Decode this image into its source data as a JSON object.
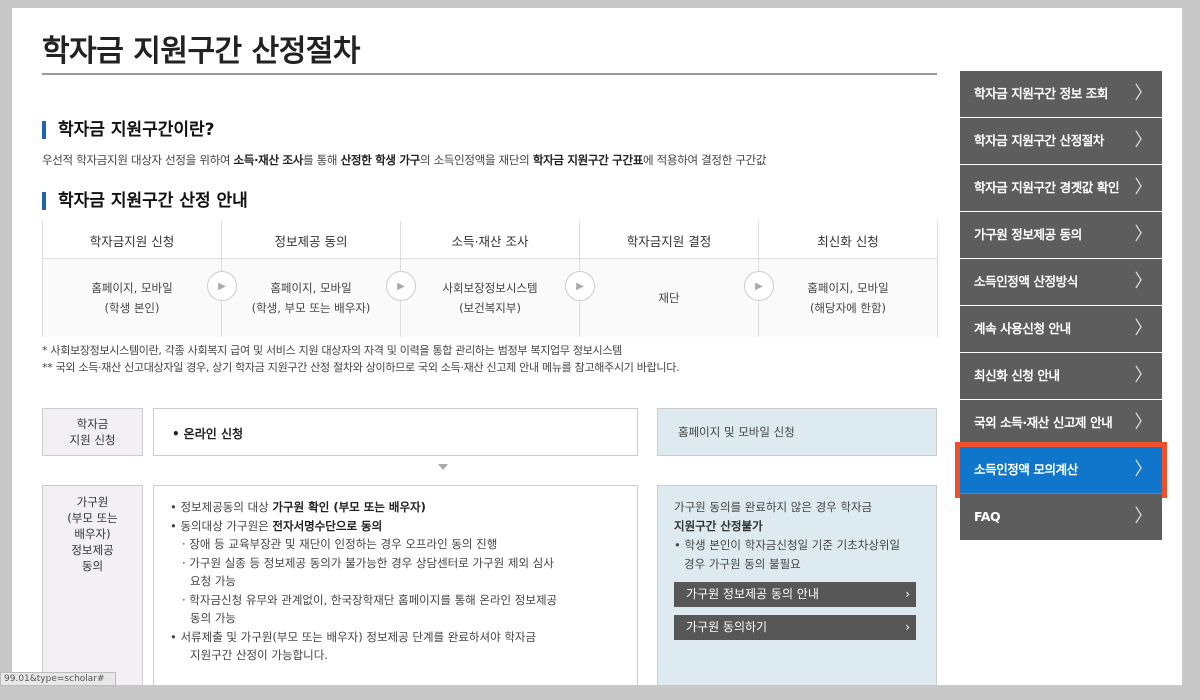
{
  "page_title": "학자금 지원구간 산정절차",
  "section1": {
    "heading": "학자금 지원구간이란?",
    "desc_pre": "우선적 학자금지원 대상자 선정을 위하여 ",
    "desc_b1": "소득·재산 조사",
    "desc_mid1": "를 통해 ",
    "desc_b2": "산정한 학생 가구",
    "desc_mid2": "의 소득인정액을 재단의 ",
    "desc_b3": "학자금 지원구간 구간표",
    "desc_post": "에 적용하여 결정한 구간값"
  },
  "section2": {
    "heading": "학자금 지원구간 산정 안내",
    "steps": [
      {
        "head": "학자금지원 신청",
        "line1": "홈페이지, 모바일",
        "line2": "(학생 본인)"
      },
      {
        "head": "정보제공 동의",
        "line1": "홈페이지, 모바일",
        "line2": "(학생, 부모 또는 배우자)"
      },
      {
        "head": "소득·재산 조사",
        "line1": "사회보장정보시스템",
        "line2": "(보건복지부)"
      },
      {
        "head": "학자금지원 결정",
        "line1": "재단",
        "line2": ""
      },
      {
        "head": "최신화 신청",
        "line1": "홈페이지, 모바일",
        "line2": "(해당자에 한함)"
      }
    ],
    "arrow_glyph": "▶",
    "note1": "* 사회보장정보시스템이란, 각종 사회복지 급여 및 서비스 지원 대상자의 자격 및 이력을 통합 관리하는 범정부 복지업무 정보시스템",
    "note2": "** 국외 소득·재산 신고대상자일 경우, 상기 학자금 지원구간 산정 절차와 상이하므로 국외 소득·재산 신고제 안내 메뉴를 참고해주시기 바랍니다."
  },
  "flow": {
    "row1": {
      "label_line1": "학자금",
      "label_line2": "지원 신청",
      "content": "온라인 신청",
      "side": "홈페이지 및 모바일 신청"
    },
    "row2": {
      "label_lines": [
        "가구원",
        "(부모 또는",
        "배우자)",
        "정보제공",
        "동의"
      ],
      "d1_pre": "정보제공동의 대상 ",
      "d1_b": "가구원 확인 (부모 또는 배우자)",
      "d2_pre": "동의대상 가구원은 ",
      "d2_b": "전자서명수단으로 동의",
      "d3": "· 장애 등 교육부장관 및 재단이 인정하는 경우 오프라인 동의 진행",
      "d4a": "· 가구원 실종 등 정보제공 동의가 불가능한 경우 상담센터로 가구원 제외 심사",
      "d4b": "요청 가능",
      "d5a": "· 학자금신청 유무와 관계없이, 한국장학재단 홈페이지를 통해 온라인 정보제공",
      "d5b": "동의 가능",
      "d6a": "서류제출 및 가구원(부모 또는 배우자) 정보제공 단계를 완료하셔야 학자금",
      "d6b": "지원구간 산정이 가능합니다.",
      "info_line1": "가구원 동의를 완료하지 않은 경우 학자금",
      "info_line2": "지원구간 산정불가",
      "info_line3": "• 학생 본인이 학자금신청일 기준 기초차상위일",
      "info_line4": "경우 가구원 동의 불필요",
      "btn1": "가구원 정보제공 동의 안내",
      "btn2": "가구원 동의하기"
    }
  },
  "sidebar": {
    "items": [
      {
        "label": "학자금 지원구간 정보 조회"
      },
      {
        "label": "학자금 지원구간 산정절차"
      },
      {
        "label": "학자금 지원구간 경곗값 확인"
      },
      {
        "label": "가구원 정보제공 동의"
      },
      {
        "label": "소득인정액 산정방식"
      },
      {
        "label": "계속 사용신청 안내"
      },
      {
        "label": "최신화 신청 안내"
      },
      {
        "label": "국외 소득·재산 신고제 안내"
      },
      {
        "label": "소득인정액 모의계산"
      },
      {
        "label": "FAQ"
      }
    ],
    "chevron": "〉"
  },
  "status_url": "99.01&type=scholar#",
  "colors": {
    "accent_blue": "#1e62b0",
    "nav_bg": "#5d5d5d",
    "nav_active": "#0f76cb",
    "highlight": "#f14f2a"
  }
}
